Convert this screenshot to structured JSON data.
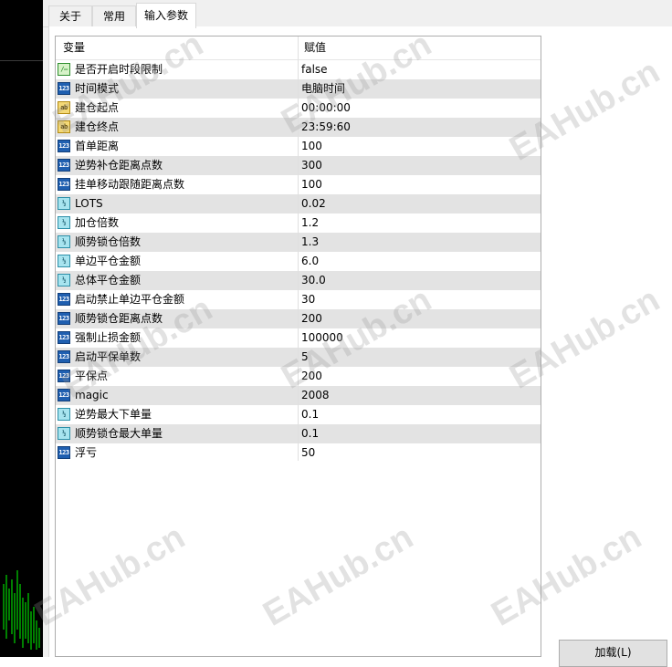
{
  "tabs": [
    {
      "label": "关于",
      "active": false
    },
    {
      "label": "常用",
      "active": false
    },
    {
      "label": "输入参数",
      "active": true
    }
  ],
  "grid": {
    "header": {
      "variable": "变量",
      "value": "赋值"
    },
    "rows": [
      {
        "type": "bool",
        "icon": "bool-icon",
        "name": "是否开启时段限制",
        "value": "false"
      },
      {
        "type": "int",
        "icon": "int-icon",
        "name": "时间模式",
        "value": "电脑时间"
      },
      {
        "type": "string",
        "icon": "string-icon",
        "name": "建仓起点",
        "value": "00:00:00"
      },
      {
        "type": "string",
        "icon": "string-icon",
        "name": "建仓终点",
        "value": "23:59:60"
      },
      {
        "type": "int",
        "icon": "int-icon",
        "name": "首单距离",
        "value": "100"
      },
      {
        "type": "int",
        "icon": "int-icon",
        "name": "逆势补仓距离点数",
        "value": "300"
      },
      {
        "type": "int",
        "icon": "int-icon",
        "name": "挂单移动跟随距离点数",
        "value": "100"
      },
      {
        "type": "double",
        "icon": "double-icon",
        "name": "LOTS",
        "value": "0.02"
      },
      {
        "type": "double",
        "icon": "double-icon",
        "name": "加仓倍数",
        "value": "1.2"
      },
      {
        "type": "double",
        "icon": "double-icon",
        "name": "顺势锁仓倍数",
        "value": "1.3"
      },
      {
        "type": "double",
        "icon": "double-icon",
        "name": "单边平仓金额",
        "value": "6.0"
      },
      {
        "type": "double",
        "icon": "double-icon",
        "name": "总体平仓金额",
        "value": "30.0"
      },
      {
        "type": "int",
        "icon": "int-icon",
        "name": "启动禁止单边平仓金额",
        "value": "30"
      },
      {
        "type": "int",
        "icon": "int-icon",
        "name": "顺势锁仓距离点数",
        "value": "200"
      },
      {
        "type": "int",
        "icon": "int-icon",
        "name": "强制止损金额",
        "value": "100000"
      },
      {
        "type": "int",
        "icon": "int-icon",
        "name": "启动平保单数",
        "value": "5"
      },
      {
        "type": "int",
        "icon": "int-icon",
        "name": "平保点",
        "value": "200"
      },
      {
        "type": "int",
        "icon": "int-icon",
        "name": "magic",
        "value": "2008"
      },
      {
        "type": "double",
        "icon": "double-icon",
        "name": "逆势最大下单量",
        "value": "0.1"
      },
      {
        "type": "double",
        "icon": "double-icon",
        "name": "顺势锁仓最大单量",
        "value": "0.1"
      },
      {
        "type": "int",
        "icon": "int-icon",
        "name": "浮亏",
        "value": "50"
      }
    ]
  },
  "icon_glyphs": {
    "bool": "∕–",
    "int": "123",
    "string": "ab",
    "double": "½"
  },
  "buttons": {
    "load": "加载(L)"
  },
  "watermark": "EAHub.cn",
  "colors": {
    "row_alt": "#e3e3e3",
    "chart_bg": "#000000",
    "candle": "#00ff00"
  }
}
